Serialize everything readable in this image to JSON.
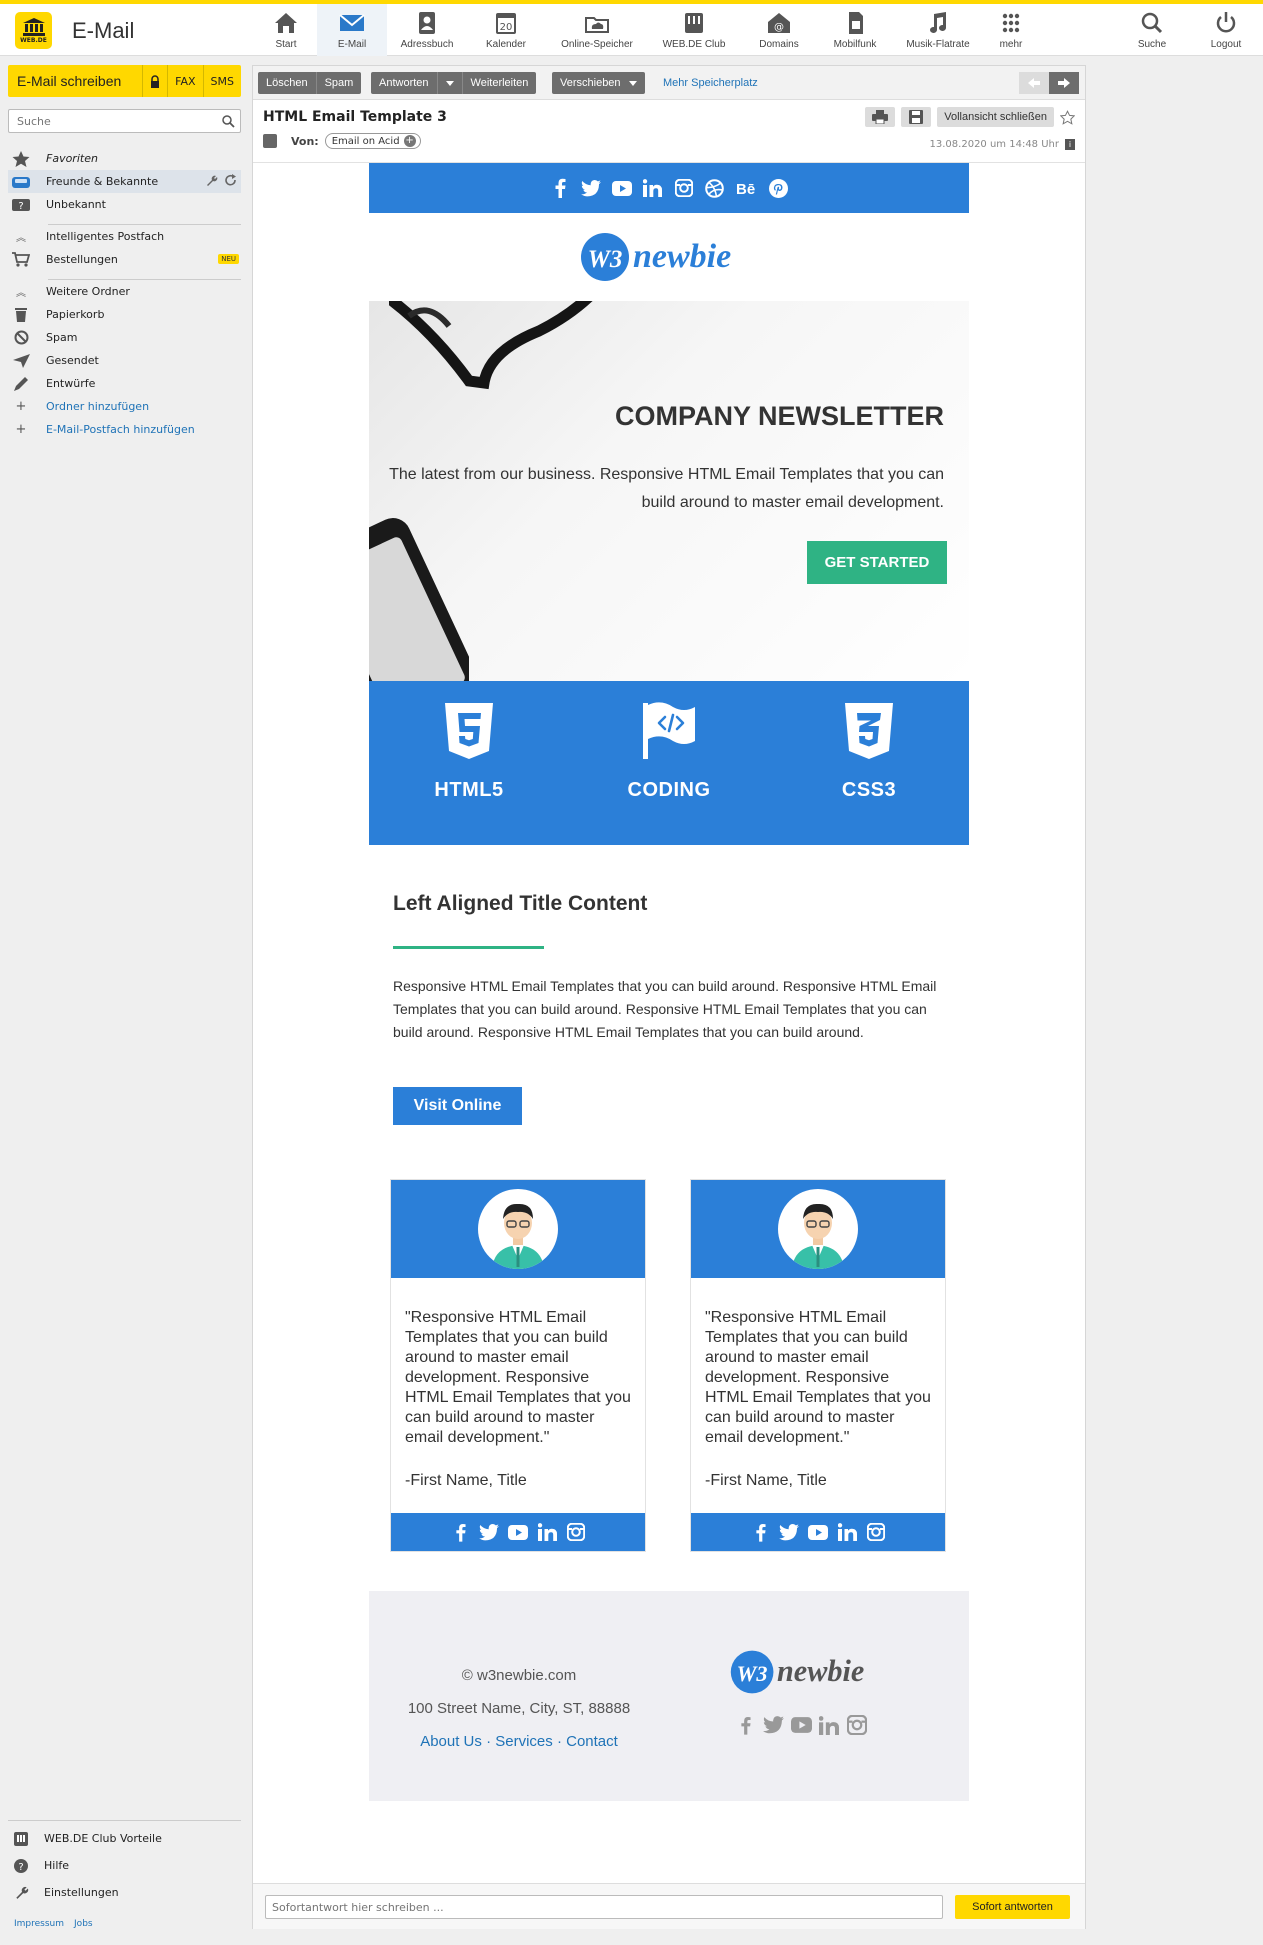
{
  "app": {
    "title": "E-Mail",
    "logo_text": "WEB.DE"
  },
  "nav": {
    "items": [
      {
        "label": "Start"
      },
      {
        "label": "E-Mail"
      },
      {
        "label": "Adressbuch"
      },
      {
        "label": "Kalender",
        "day": "20"
      },
      {
        "label": "Online-Speicher"
      },
      {
        "label": "WEB.DE Club"
      },
      {
        "label": "Domains"
      },
      {
        "label": "Mobilfunk"
      },
      {
        "label": "Musik-Flatrate"
      },
      {
        "label": "mehr"
      }
    ],
    "right": [
      {
        "label": "Suche"
      },
      {
        "label": "Logout"
      }
    ]
  },
  "sidebar": {
    "compose": "E-Mail schreiben",
    "fax": "FAX",
    "sms": "SMS",
    "search_placeholder": "Suche",
    "favorites": "Favoriten",
    "friends": "Freunde & Bekannte",
    "unknown": "Unbekannt",
    "smart_inbox": "Intelligentes Postfach",
    "orders": "Bestellungen",
    "new_badge": "NEU",
    "more_folders": "Weitere Ordner",
    "trash": "Papierkorb",
    "spam": "Spam",
    "sent": "Gesendet",
    "drafts": "Entwürfe",
    "add_folder": "Ordner hinzufügen",
    "add_mailbox": "E-Mail-Postfach hinzufügen",
    "club": "WEB.DE Club Vorteile",
    "help": "Hilfe",
    "settings": "Einstellungen",
    "impressum": "Impressum",
    "jobs": "Jobs"
  },
  "toolbar": {
    "delete": "Löschen",
    "spam": "Spam",
    "reply": "Antworten",
    "forward": "Weiterleiten",
    "move": "Verschieben",
    "more_storage": "Mehr Speicherplatz"
  },
  "message": {
    "subject": "HTML Email Template 3",
    "from_label": "Von:",
    "from_name": "Email on Acid",
    "full_view": "Vollansicht schließen",
    "date": "13.08.2020 um 14:48 Uhr"
  },
  "email": {
    "brand": "newbie",
    "brand_mark": "W3",
    "hero_title": "COMPANY NEWSLETTER",
    "hero_text": "The latest from our business. Responsive HTML Email Templates that you can build around to master email development.",
    "hero_cta": "GET STARTED",
    "features": [
      {
        "label": "HTML5"
      },
      {
        "label": "CODING"
      },
      {
        "label": "CSS3"
      }
    ],
    "content_title": "Left Aligned Title Content",
    "content_text": "Responsive HTML Email Templates that you can build around. Responsive HTML Email Templates that you can build around. Responsive HTML Email Templates that you can build around. Responsive HTML Email Templates that you can build around.",
    "visit": "Visit Online",
    "testimonials": [
      {
        "quote": "\"Responsive HTML Email Templates that you can build around to master email development. Responsive HTML Email Templates that you can build around to master email development.\"",
        "author": "-First Name, Title"
      },
      {
        "quote": "\"Responsive HTML Email Templates that you can build around to master email development. Responsive HTML Email Templates that you can build around to master email development.\"",
        "author": "-First Name, Title"
      }
    ],
    "footer": {
      "copyright": "© w3newbie.com",
      "address": "100 Street Name, City, ST, 88888",
      "links": [
        "About Us",
        "Services",
        "Contact"
      ],
      "sep": "·"
    }
  },
  "reply": {
    "placeholder": "Sofortantwort hier schreiben ...",
    "send": "Sofort antworten"
  },
  "colors": {
    "accent": "#ffd800",
    "email_blue": "#2b7fd8",
    "email_green": "#2fb384",
    "link": "#1f73b7"
  }
}
